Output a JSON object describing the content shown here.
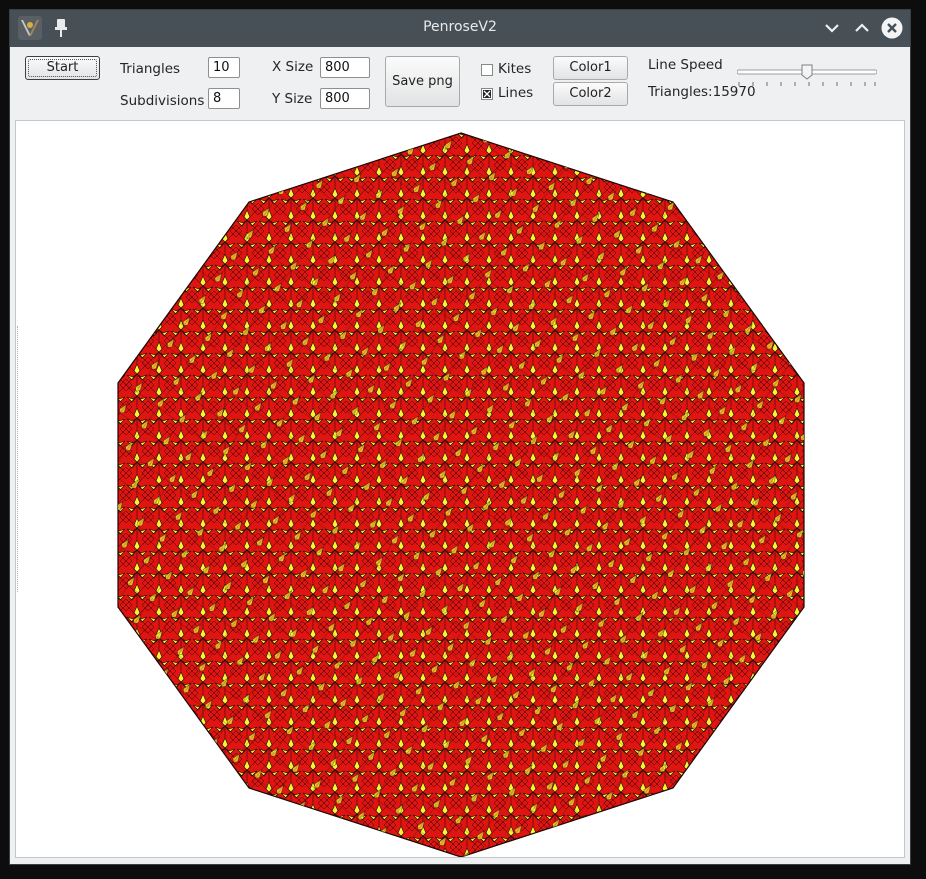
{
  "window": {
    "title": "PenroseV2"
  },
  "controls": {
    "start_label": "Start",
    "triangles_label": "Triangles",
    "triangles_value": "10",
    "subdivisions_label": "Subdivisions",
    "subdivisions_value": "8",
    "xsize_label": "X Size",
    "xsize_value": "800",
    "ysize_label": "Y Size",
    "ysize_value": "800",
    "save_label": "Save png",
    "kites_label": "Kites",
    "kites_checked": false,
    "lines_label": "Lines",
    "lines_checked": true,
    "color1_label": "Color1",
    "color2_label": "Color2",
    "line_speed_label": "Line Speed",
    "line_speed_fraction": 0.5,
    "triangles_count_label": "Triangles:15970"
  },
  "canvas": {
    "shape": "decagon",
    "color_primary": "#e01410",
    "color_secondary": "#f7f530",
    "line_color": "#1a0404"
  }
}
